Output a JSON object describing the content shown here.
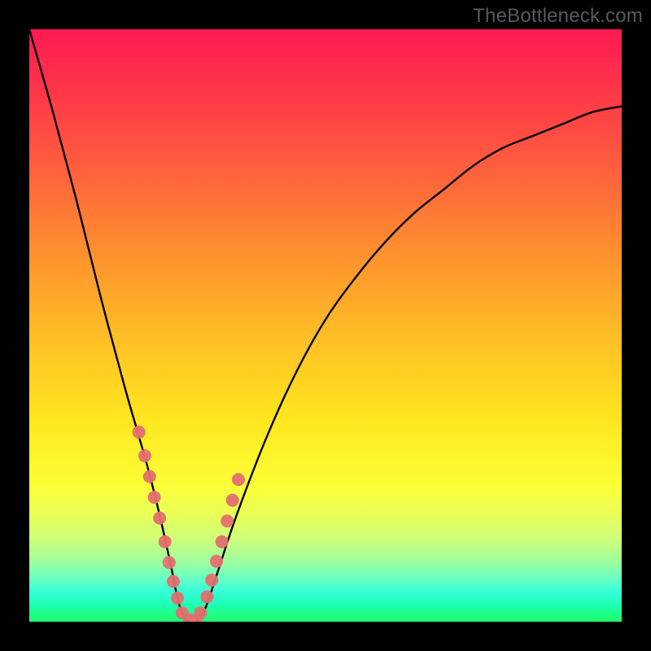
{
  "watermark": "TheBottleneck.com",
  "colors": {
    "dot": "#e36f6f",
    "curve": "#000000",
    "frame": "#000000"
  },
  "chart_data": {
    "type": "line",
    "title": "",
    "xlabel": "",
    "ylabel": "",
    "xlim": [
      0,
      100
    ],
    "ylim": [
      0,
      100
    ],
    "grid": false,
    "legend": false,
    "note": "Axes have no visible tick labels; x and y are normalized 0–100. y represents bottleneck % (0 at bottom). Curve reaches a minimum (~0%) near x≈27.",
    "series": [
      {
        "name": "bottleneck-curve",
        "x": [
          0,
          4,
          8,
          12,
          16,
          18,
          20,
          22,
          24,
          25,
          26,
          27,
          28,
          29,
          30,
          32,
          35,
          40,
          45,
          50,
          55,
          60,
          65,
          70,
          75,
          80,
          85,
          90,
          95,
          100
        ],
        "y": [
          100,
          86,
          71,
          55,
          40,
          33,
          26,
          18,
          9,
          4,
          1,
          0,
          0,
          1,
          3,
          9,
          18,
          31,
          42,
          51,
          58,
          64,
          69,
          73,
          77,
          80,
          82,
          84,
          86,
          87
        ]
      }
    ],
    "highlight_points": {
      "name": "marker-dots",
      "x": [
        18.5,
        19.5,
        20.3,
        21.1,
        22.0,
        22.9,
        23.6,
        24.3,
        25.0,
        25.8,
        27.0,
        28.2,
        28.9,
        30.0,
        30.8,
        31.6,
        32.5,
        33.4,
        34.3,
        35.3
      ],
      "y": [
        32.0,
        28.0,
        24.5,
        21.0,
        17.5,
        13.5,
        10.0,
        6.8,
        4.0,
        1.5,
        0.3,
        0.3,
        1.5,
        4.2,
        7.0,
        10.2,
        13.5,
        17.0,
        20.5,
        24.0
      ]
    }
  }
}
